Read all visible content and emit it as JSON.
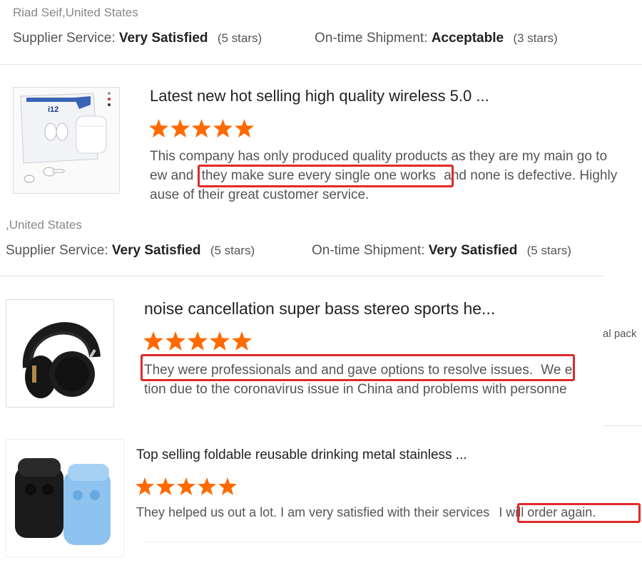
{
  "review1": {
    "location": "Riad Seif,United States",
    "supplier_label": "Supplier Service:",
    "supplier_value": "Very Satisfied",
    "supplier_stars": "(5 stars)",
    "shipment_label": "On-time Shipment:",
    "shipment_value": "Acceptable",
    "shipment_stars": "(3 stars)"
  },
  "review2": {
    "title": "Latest new hot selling high quality wireless 5.0 ...",
    "line1": "This company has only produced quality products as they are my main go to",
    "line2a": "ew and",
    "line2_highlight": "they make sure every single one works",
    "line2b": "and none is defective. Highly",
    "line3": "ause of their great customer service.",
    "location": ",United States",
    "supplier_label": "Supplier Service:",
    "supplier_value": "Very Satisfied",
    "supplier_stars": "(5 stars)",
    "shipment_label": "On-time Shipment:",
    "shipment_value": "Very Satisfied",
    "shipment_stars": "(5 stars)",
    "box_label": "i12"
  },
  "review3": {
    "title": "noise cancellation super bass stereo sports he...",
    "side_text": "al pack",
    "line1_highlight": "They were professionals and and gave options to resolve issues.",
    "line1b": "We e",
    "line2": "tion due to the coronavirus issue in China and problems with personne"
  },
  "review4": {
    "title": "Top selling foldable reusable drinking metal stainless ...",
    "line1a": "They helped us out a lot. I am very satisfied with their services",
    "line1_highlight": "I will order again."
  },
  "colors": {
    "star": "#ff6a00",
    "highlight": "#e0292a"
  }
}
